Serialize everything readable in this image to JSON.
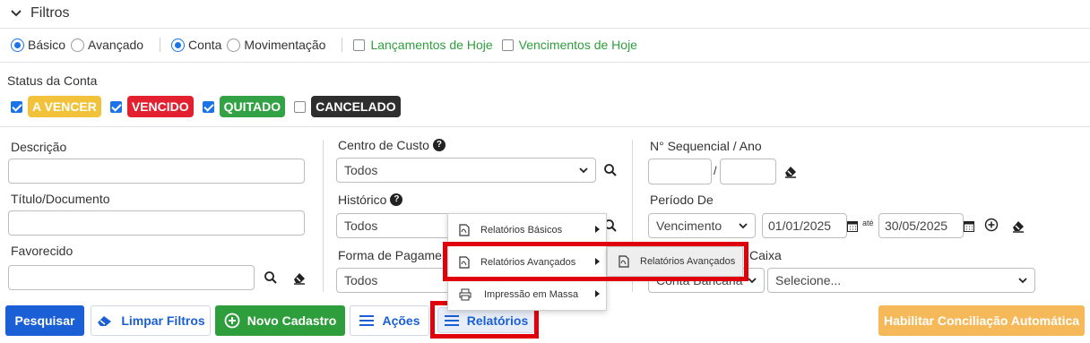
{
  "header": {
    "title": "Filtros",
    "toggle_icon": "chevron-down-icon"
  },
  "options": {
    "basico": "Básico",
    "avancado": "Avançado",
    "conta": "Conta",
    "movimentacao": "Movimentação",
    "lancamentos_hoje": "Lançamentos de Hoje",
    "vencimentos_hoje": "Vencimentos de Hoje"
  },
  "status": {
    "label": "Status da Conta",
    "badges": [
      "A VENCER",
      "VENCIDO",
      "QUITADO",
      "CANCELADO"
    ]
  },
  "left": {
    "descricao": "Descrição",
    "titulo": "Título/Documento",
    "favorecido": "Favorecido"
  },
  "middle": {
    "centro_custo": "Centro de Custo",
    "centro_custo_value": "Todos",
    "historico": "Histórico",
    "historico_value": "Todos",
    "forma_pagamento": "Forma de Pagamen",
    "forma_pagamento_value": "Todos"
  },
  "right": {
    "sequencial": "N° Sequencial / Ano",
    "sequencial_sep": "/",
    "periodo": "Período De",
    "periodo_value": "Vencimento",
    "date_from": "01/01/2025",
    "ate": "até",
    "date_to": "30/05/2025",
    "caixa_label": "Caixa",
    "conta_bancaria": "Conta Bancária",
    "selecione": "Selecione..."
  },
  "buttons": {
    "pesquisar": "Pesquisar",
    "limpar": "Limpar Filtros",
    "novo": "Novo Cadastro",
    "acoes": "Ações",
    "relatorios": "Relatórios",
    "conciliacao": "Habilitar Conciliação Automática"
  },
  "menu": {
    "basicos": "Relatórios Básicos",
    "avancados": "Relatórios Avançados",
    "massa": "Impressão em Massa",
    "sub_avancados": "Relatórios Avançados"
  },
  "colors": {
    "primary": "#1a5fd6",
    "green": "#2e9e3c",
    "yellow": "#f2c23a",
    "red": "#e3202f",
    "dark": "#2e2e2e",
    "orange": "#f6b95a",
    "highlight": "#e0000b"
  }
}
